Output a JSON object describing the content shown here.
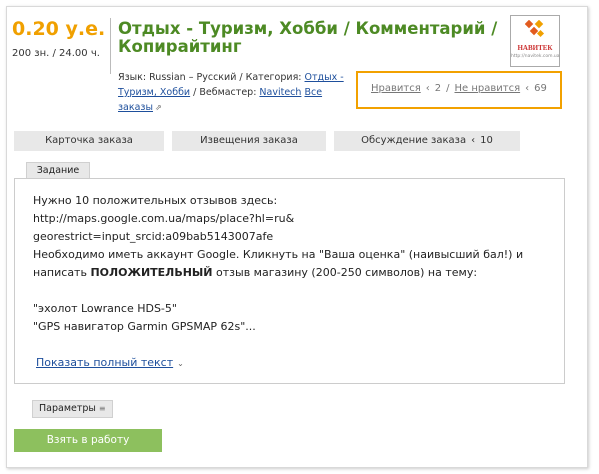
{
  "price": {
    "main": "0.20 у.е.",
    "secondary": "200 зн. / 24.00 ч."
  },
  "order": {
    "title": "Отдых - Туризм, Хобби / Комментарий / Копирайтинг"
  },
  "logo": {
    "text": "НАВИТЕК",
    "url": "http://navitek.com.ua"
  },
  "meta": {
    "language_prefix": "Язык: ",
    "language": "Russian – Русский",
    "category_prefix": " / Категория: ",
    "category": "Отдых - Туризм, Хобби",
    "webmaster_prefix": " / Вебмастер: ",
    "webmaster": "Navitech",
    "all_orders_link": "Все заказы"
  },
  "votes": {
    "like_label": "Нравится",
    "like_count": "2",
    "dislike_label": "Не нравится",
    "dislike_count": "69",
    "highlight_color": "#f2a100"
  },
  "tabs": [
    {
      "label": "Карточка заказа"
    },
    {
      "label": "Извещения заказа"
    },
    {
      "label": "Обсуждение заказа",
      "count": "10"
    }
  ],
  "task": {
    "section_label": "Задание",
    "lines": [
      "Нужно 10 положительных отзывов здесь:",
      "http://maps.google.com.ua/maps/place?hl=ru&",
      "georestrict=input_srcid:a09bab5143007afe",
      "Необходимо иметь аккаунт Google. Кликнуть на \"Ваша оценка\" (наивысший бал!) и"
    ],
    "line5_before": "написать ",
    "line5_bold": "ПОЛОЖИТЕЛЬНЫЙ",
    "line5_after": " отзыв магазину (200-250 символов) на тему:",
    "quote1": "\"эхолот Lowrance HDS-5\"",
    "quote2": "\"GPS навигатор Garmin GPSMAP 62s\"...",
    "show_full": "Показать полный текст"
  },
  "params_label": "Параметры",
  "take_button": "Взять в работу",
  "colors": {
    "price": "#f0a000",
    "title": "#4d8a24",
    "button": "#8dc05e",
    "link": "#1e4f9c"
  }
}
